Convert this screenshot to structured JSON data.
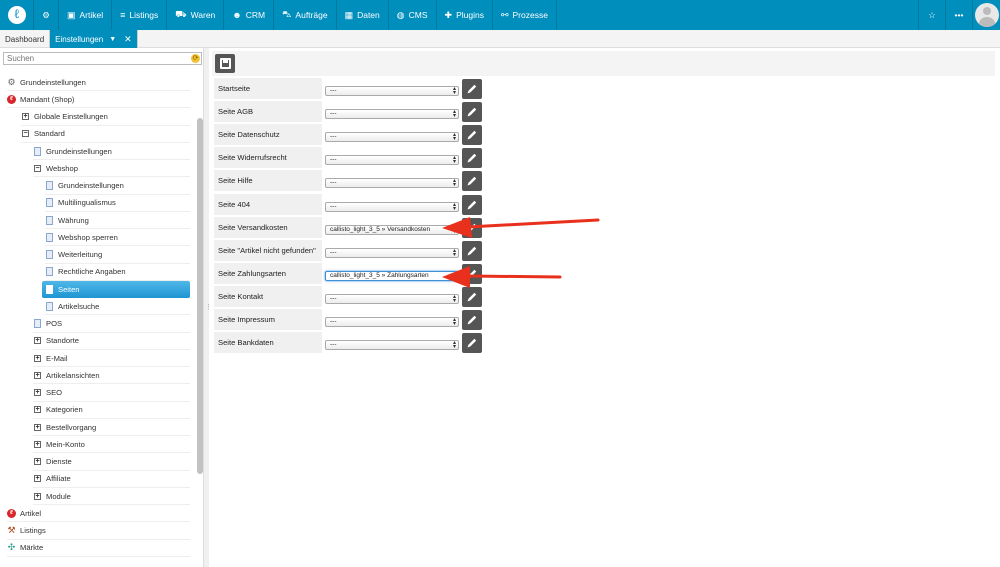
{
  "topnav": {
    "items": [
      {
        "label": "Artikel",
        "icon": "tag-icon"
      },
      {
        "label": "Listings",
        "icon": "list-icon"
      },
      {
        "label": "Waren",
        "icon": "truck-icon"
      },
      {
        "label": "CRM",
        "icon": "users-icon"
      },
      {
        "label": "Aufträge",
        "icon": "cart-icon"
      },
      {
        "label": "Daten",
        "icon": "table-icon"
      },
      {
        "label": "CMS",
        "icon": "globe-icon"
      },
      {
        "label": "Plugins",
        "icon": "puzzle-icon"
      },
      {
        "label": "Prozesse",
        "icon": "flow-icon"
      }
    ]
  },
  "tabs": [
    {
      "label": "Dashboard"
    },
    {
      "label": "Einstellungen"
    }
  ],
  "search": {
    "placeholder": "Suchen"
  },
  "tree": [
    {
      "label": "Grundeinstellungen",
      "icon": "gear-icon",
      "level": 0
    },
    {
      "label": "Mandant (Shop)",
      "icon": "plenty-icon",
      "level": 0
    },
    {
      "label": "Globale Einstellungen",
      "icon": "plus-box-icon",
      "level": 1
    },
    {
      "label": "Standard",
      "icon": "minus-box-icon",
      "level": 1
    },
    {
      "label": "Grundeinstellungen",
      "icon": "document-icon",
      "level": 2
    },
    {
      "label": "Webshop",
      "icon": "minus-box-icon",
      "level": 2
    },
    {
      "label": "Grundeinstellungen",
      "icon": "document-icon",
      "level": 3
    },
    {
      "label": "Multilingualismus",
      "icon": "document-icon",
      "level": 3
    },
    {
      "label": "Währung",
      "icon": "document-icon",
      "level": 3
    },
    {
      "label": "Webshop sperren",
      "icon": "document-icon",
      "level": 3
    },
    {
      "label": "Weiterleitung",
      "icon": "document-icon",
      "level": 3
    },
    {
      "label": "Rechtliche Angaben",
      "icon": "document-icon",
      "level": 3
    },
    {
      "label": "Seiten",
      "icon": "document-icon",
      "level": 3,
      "selected": true
    },
    {
      "label": "Artikelsuche",
      "icon": "document-icon",
      "level": 3
    },
    {
      "label": "POS",
      "icon": "document-icon",
      "level": 2
    },
    {
      "label": "Standorte",
      "icon": "plus-box-icon",
      "level": 2
    },
    {
      "label": "E-Mail",
      "icon": "plus-box-icon",
      "level": 2
    },
    {
      "label": "Artikelansichten",
      "icon": "plus-box-icon",
      "level": 2
    },
    {
      "label": "SEO",
      "icon": "plus-box-icon",
      "level": 2
    },
    {
      "label": "Kategorien",
      "icon": "plus-box-icon",
      "level": 2
    },
    {
      "label": "Bestellvorgang",
      "icon": "plus-box-icon",
      "level": 2
    },
    {
      "label": "Mein-Konto",
      "icon": "plus-box-icon",
      "level": 2
    },
    {
      "label": "Dienste",
      "icon": "plus-box-icon",
      "level": 2
    },
    {
      "label": "Affiliate",
      "icon": "plus-box-icon",
      "level": 2
    },
    {
      "label": "Module",
      "icon": "plus-box-icon",
      "level": 2
    },
    {
      "label": "Artikel",
      "icon": "plenty-icon",
      "level": 0
    },
    {
      "label": "Listings",
      "icon": "hammer-icon",
      "level": 0
    },
    {
      "label": "Märkte",
      "icon": "puzzle-icon",
      "level": 0
    }
  ],
  "settings": [
    {
      "label": "Startseite",
      "value": "---"
    },
    {
      "label": "Seite AGB",
      "value": "---"
    },
    {
      "label": "Seite Datenschutz",
      "value": "---"
    },
    {
      "label": "Seite Widerrufsrecht",
      "value": "---"
    },
    {
      "label": "Seite Hilfe",
      "value": "---"
    },
    {
      "label": "Seite 404",
      "value": "---"
    },
    {
      "label": "Seite Versandkosten",
      "value": "callisto_light_3_5 » Versandkosten"
    },
    {
      "label": "Seite \"Artikel nicht gefunden\"",
      "value": "---"
    },
    {
      "label": "Seite Zahlungsarten",
      "value": "callisto_light_3_5 » Zahlungsarten",
      "focused": true
    },
    {
      "label": "Seite Kontakt",
      "value": "---"
    },
    {
      "label": "Seite Impressum",
      "value": "---"
    },
    {
      "label": "Seite Bankdaten",
      "value": "---"
    }
  ],
  "colors": {
    "nav": "#008ebd",
    "selected": "#1e95d3",
    "arrow": "#e8301c"
  }
}
